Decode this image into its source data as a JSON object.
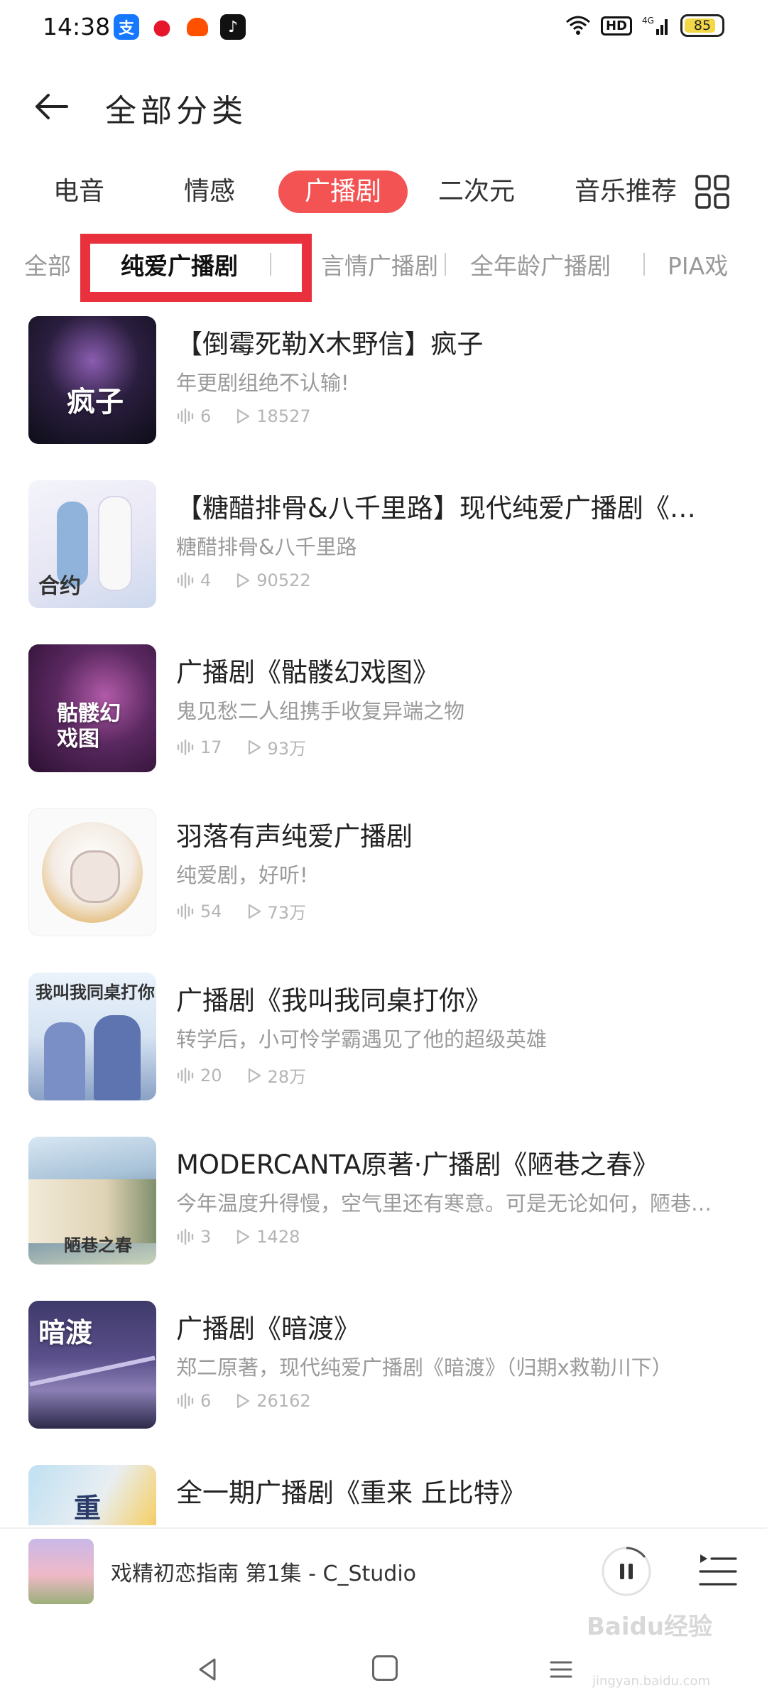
{
  "status_bar": {
    "time": "14:38",
    "apps": [
      "alipay-icon",
      "weibo-icon",
      "taobao-icon",
      "douyin-icon"
    ],
    "network": "4G",
    "hd_label": "HD",
    "battery_level": "85"
  },
  "header": {
    "title": "全部分类"
  },
  "category_tabs": {
    "items": [
      "电音",
      "情感",
      "广播剧",
      "二次元",
      "音乐推荐"
    ],
    "active_index": 2,
    "active_color": "#f35353"
  },
  "sub_tabs": {
    "items": [
      "全部",
      "纯爱广播剧",
      "言情广播剧",
      "全年龄广播剧",
      "PIA戏"
    ],
    "active_index": 1,
    "highlight_color": "#e8313c"
  },
  "items": [
    {
      "title": "【倒霉死勒X木野信】疯子",
      "desc": "年更剧组绝不认输!",
      "episodes": "6",
      "plays": "18527",
      "cover_text": "疯子"
    },
    {
      "title": "【糖醋排骨&八千里路】现代纯爱广播剧《…",
      "desc": "糖醋排骨&八千里路",
      "episodes": "4",
      "plays": "90522",
      "cover_text": "合约"
    },
    {
      "title": "广播剧《骷髅幻戏图》",
      "desc": "鬼见愁二人组携手收复异端之物",
      "episodes": "17",
      "plays": "93万",
      "cover_text": "骷髅幻戏图"
    },
    {
      "title": "羽落有声纯爱广播剧",
      "desc": "纯爱剧，好听!",
      "episodes": "54",
      "plays": "73万",
      "cover_text": ""
    },
    {
      "title": "广播剧《我叫我同桌打你》",
      "desc": "转学后，小可怜学霸遇见了他的超级英雄",
      "episodes": "20",
      "plays": "28万",
      "cover_text": "我叫我同桌打你"
    },
    {
      "title": "MODERCANTA原著·广播剧《陋巷之春》",
      "desc": "今年温度升得慢，空气里还有寒意。可是无论如何，陋巷…",
      "episodes": "3",
      "plays": "1428",
      "cover_text": "陋巷之春"
    },
    {
      "title": "广播剧《暗渡》",
      "desc": "郑二原著，现代纯爱广播剧《暗渡》（归期x救勒川下）",
      "episodes": "6",
      "plays": "26162",
      "cover_text": "暗渡"
    },
    {
      "title": "全一期广播剧《重来 丘比特》",
      "desc": "",
      "episodes": "",
      "plays": "",
      "cover_text": "重"
    }
  ],
  "player": {
    "title": "戏精初恋指南 第1集 - C_Studio"
  },
  "watermark": {
    "text": "Baidu经验",
    "sub": "jingyan.baidu.com"
  }
}
